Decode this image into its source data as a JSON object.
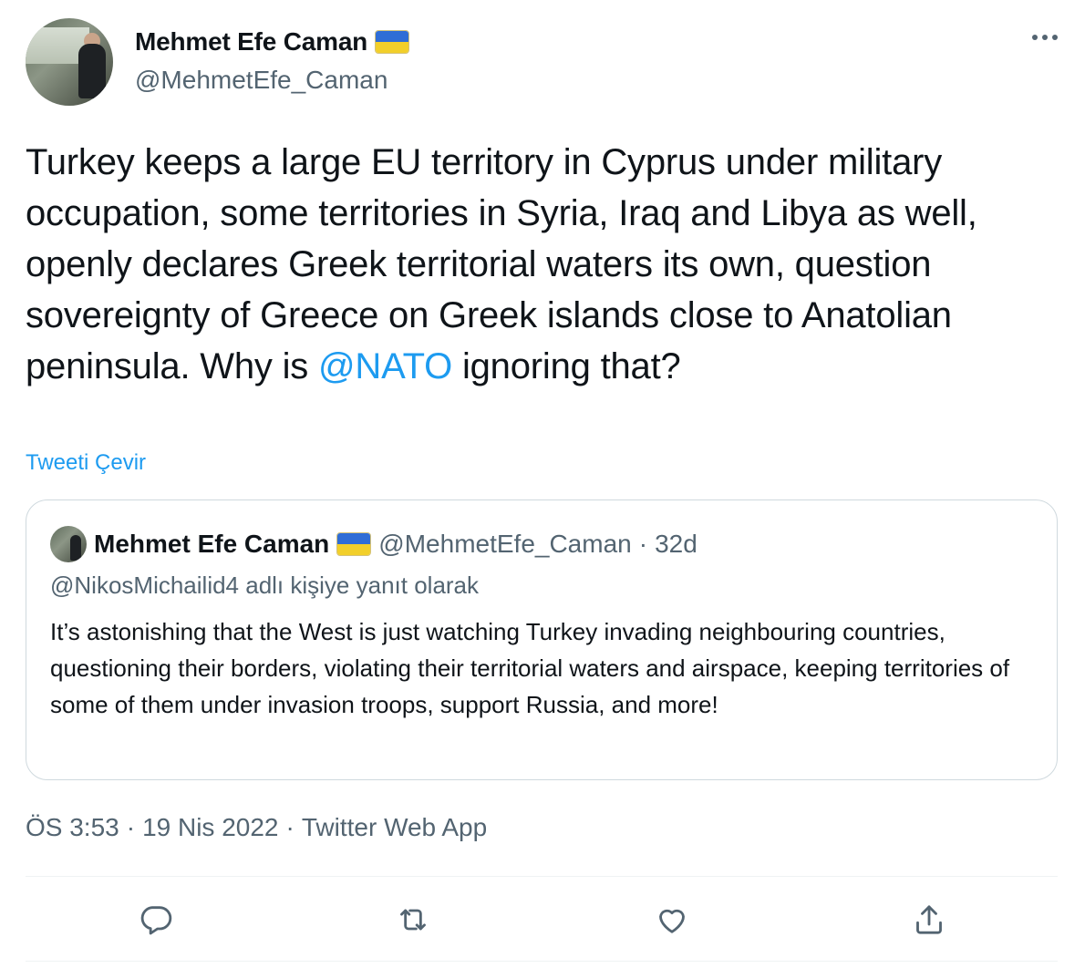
{
  "author": {
    "name": "Mehmet Efe Caman",
    "handle": "@MehmetEfe_Caman"
  },
  "tweet": {
    "text_before_mention": "Turkey keeps a large EU territory in Cyprus under military occupation, some territories in Syria, Iraq and Libya as well, openly declares Greek territorial waters its own, question sovereignty of Greece on Greek islands close to Anatolian peninsula. Why is ",
    "mention": "@NATO",
    "text_after_mention": " ignoring that?",
    "translate_label": "Tweeti Çevir"
  },
  "quote": {
    "name": "Mehmet Efe Caman",
    "handle": "@MehmetEfe_Caman",
    "separator": "·",
    "time": "32d",
    "reply_context": "@NikosMichailid4 adlı kişiye yanıt olarak",
    "text": "It’s astonishing that the West is just watching Turkey invading neighbouring countries, questioning their borders, violating their territorial waters and airspace, keeping territories of some of them under invasion troops, support Russia, and more!"
  },
  "meta": {
    "time": "ÖS 3:53",
    "sep1": "·",
    "date": "19 Nis 2022",
    "sep2": "·",
    "source": "Twitter Web App"
  },
  "colors": {
    "accent": "#1d9bf0",
    "secondary_text": "#536471",
    "border": "#cfd9de",
    "flag_blue": "#2f6dd6",
    "flag_yellow": "#f2cf2a"
  },
  "icons": [
    "more-icon",
    "reply-icon",
    "retweet-icon",
    "like-icon",
    "share-icon"
  ]
}
